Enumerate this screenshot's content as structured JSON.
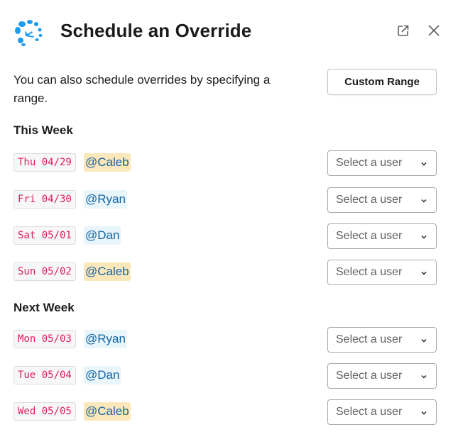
{
  "header": {
    "title": "Schedule an Override",
    "logo_icon": "clock-splash-icon",
    "popout_icon": "external-link-icon",
    "close_icon": "close-icon"
  },
  "intro": {
    "text": "You can also schedule overrides by specifying a range.",
    "custom_range_label": "Custom Range"
  },
  "colors": {
    "date_text": "#e01e5a",
    "mention_text": "#1264a3",
    "mention_self_bg": "#fbe7b9",
    "mention_other_bg": "#e8f5fa",
    "logo": "#1d9bf0"
  },
  "sections": [
    {
      "title": "This Week",
      "rows": [
        {
          "date": "Thu 04/29",
          "user": "@Caleb",
          "highlight": "self",
          "select_placeholder": "Select a user"
        },
        {
          "date": "Fri 04/30",
          "user": "@Ryan",
          "highlight": "other",
          "select_placeholder": "Select a user"
        },
        {
          "date": "Sat 05/01",
          "user": "@Dan",
          "highlight": "other",
          "select_placeholder": "Select a user"
        },
        {
          "date": "Sun 05/02",
          "user": "@Caleb",
          "highlight": "self",
          "select_placeholder": "Select a user"
        }
      ]
    },
    {
      "title": "Next Week",
      "rows": [
        {
          "date": "Mon 05/03",
          "user": "@Ryan",
          "highlight": "other",
          "select_placeholder": "Select a user"
        },
        {
          "date": "Tue 05/04",
          "user": "@Dan",
          "highlight": "other",
          "select_placeholder": "Select a user"
        },
        {
          "date": "Wed 05/05",
          "user": "@Caleb",
          "highlight": "self",
          "select_placeholder": "Select a user"
        }
      ]
    }
  ]
}
